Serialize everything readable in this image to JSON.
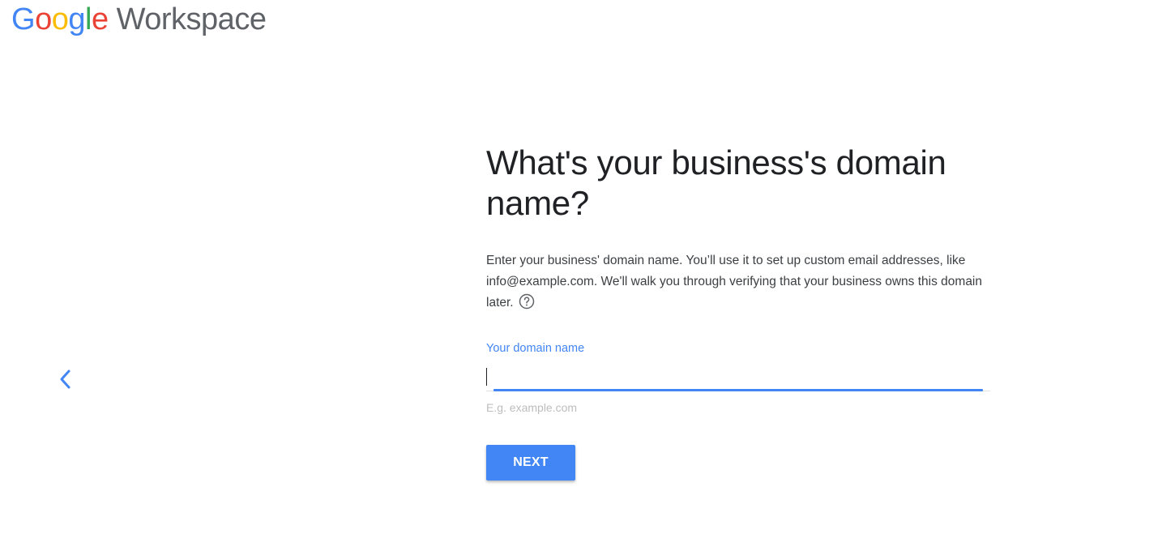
{
  "brand": {
    "letters": [
      "G",
      "o",
      "o",
      "g",
      "l",
      "e"
    ],
    "product": "Workspace",
    "colors": {
      "blue": "#4285f4",
      "red": "#ea4335",
      "yellow": "#fbbc05",
      "green": "#34a853",
      "gray": "#5f6368"
    }
  },
  "navigation": {
    "back_icon": "chevron-left-icon"
  },
  "main": {
    "title": "What's your business's domain name?",
    "description": "Enter your business' domain name. You’ll use it to set up custom email addresses, like info@example.com. We'll walk you through verifying that your business owns this domain later.",
    "help_icon": "help-circle-icon",
    "domain_field": {
      "label": "Your domain name",
      "value": "",
      "hint": "E.g. example.com"
    },
    "next_label": "NEXT"
  },
  "theme": {
    "accent": "#4285f4",
    "text": "#202124",
    "hint": "#bdbdbd"
  }
}
